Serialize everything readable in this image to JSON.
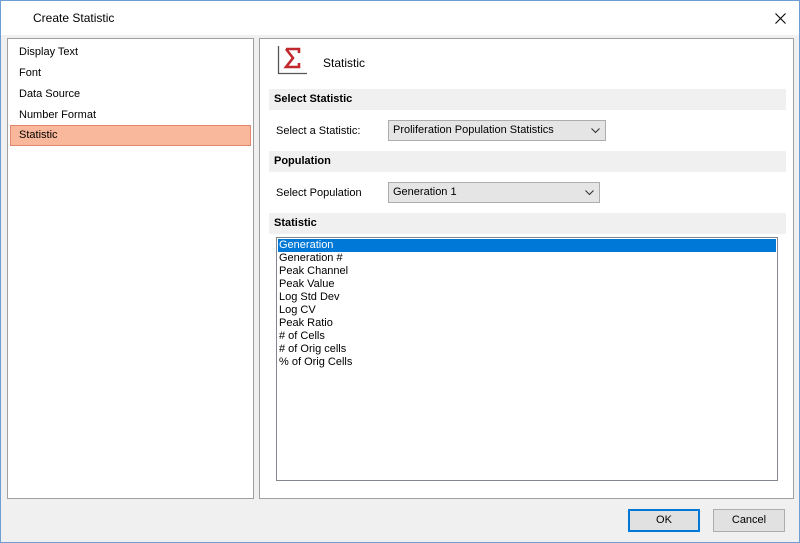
{
  "window": {
    "title": "Create Statistic"
  },
  "nav": {
    "items": [
      {
        "label": "Display Text",
        "selected": false
      },
      {
        "label": "Font",
        "selected": false
      },
      {
        "label": "Data Source",
        "selected": false
      },
      {
        "label": "Number Format",
        "selected": false
      },
      {
        "label": "Statistic",
        "selected": true
      }
    ]
  },
  "header": {
    "title": "Statistic",
    "icon": "sigma-icon",
    "icon_color": "#c0282d"
  },
  "select_statistic": {
    "heading": "Select Statistic",
    "label": "Select a Statistic:",
    "value": "Proliferation Population Statistics"
  },
  "population": {
    "heading": "Population",
    "label": "Select Population",
    "value": "Generation 1"
  },
  "statistic": {
    "heading": "Statistic",
    "items": [
      {
        "label": "Generation",
        "selected": true
      },
      {
        "label": "Generation #",
        "selected": false
      },
      {
        "label": "Peak Channel",
        "selected": false
      },
      {
        "label": "Peak Value",
        "selected": false
      },
      {
        "label": "Log Std Dev",
        "selected": false
      },
      {
        "label": "Log CV",
        "selected": false
      },
      {
        "label": "Peak Ratio",
        "selected": false
      },
      {
        "label": "# of Cells",
        "selected": false
      },
      {
        "label": "# of Orig cells",
        "selected": false
      },
      {
        "label": "% of Orig Cells",
        "selected": false
      }
    ]
  },
  "buttons": {
    "ok": "OK",
    "cancel": "Cancel"
  },
  "colors": {
    "accent": "#0078d7",
    "nav_selected": "#f9b79b"
  }
}
